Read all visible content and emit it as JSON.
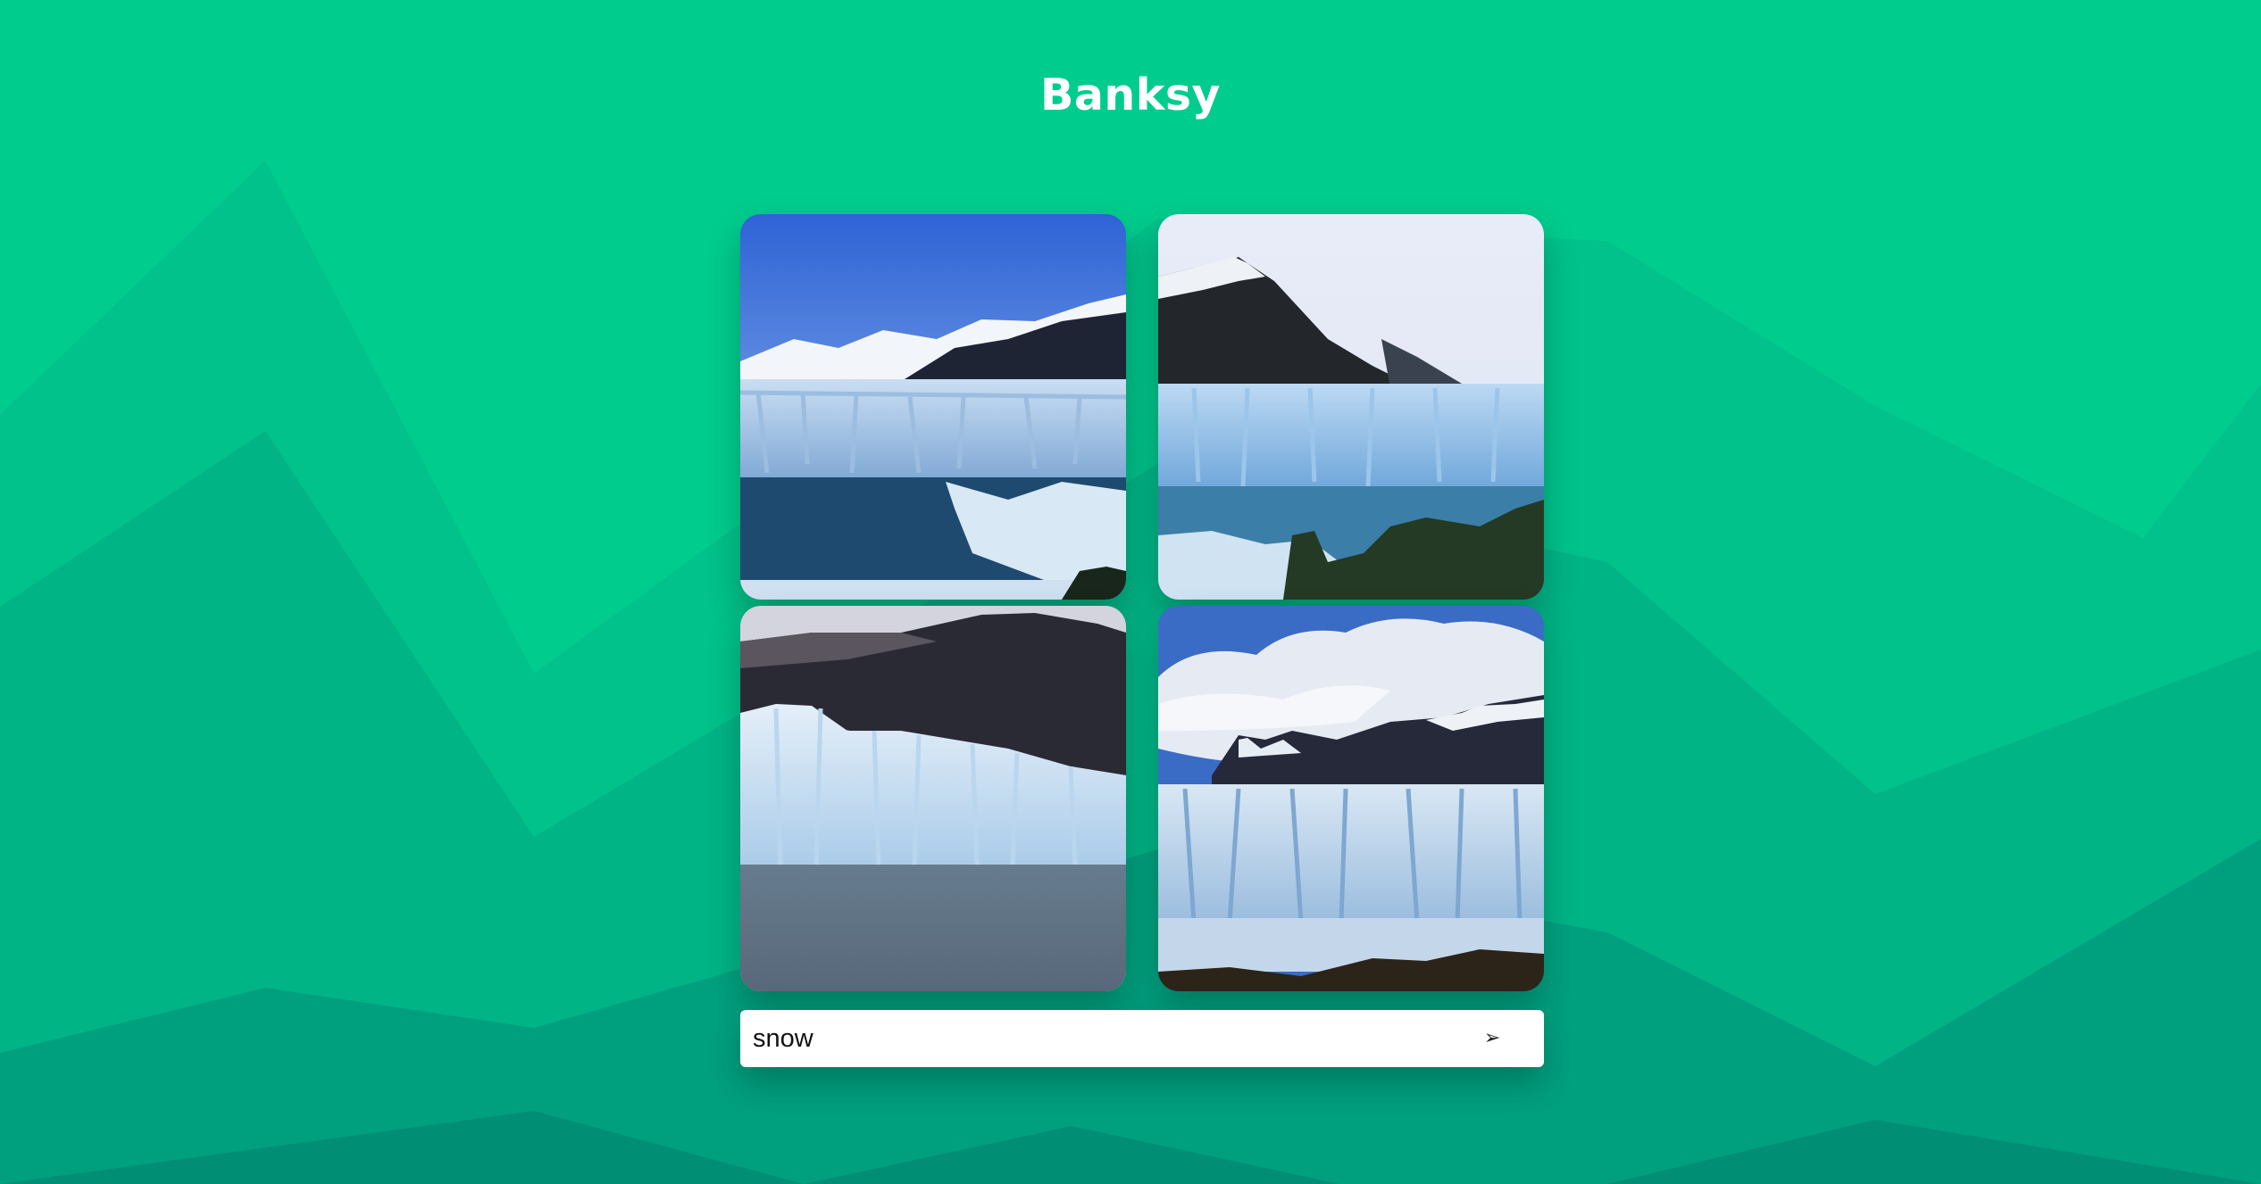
{
  "header": {
    "title": "Banksy"
  },
  "search": {
    "value": "snow",
    "send_icon": "➢"
  },
  "gallery": {
    "images": [
      {
        "subject": "glacier-with-mountains"
      },
      {
        "subject": "glacier-with-peak"
      },
      {
        "subject": "glacier-wall"
      },
      {
        "subject": "glacier-under-clouds"
      }
    ]
  },
  "colors": {
    "background": "#00cc8e",
    "accent": "#ffffff"
  }
}
